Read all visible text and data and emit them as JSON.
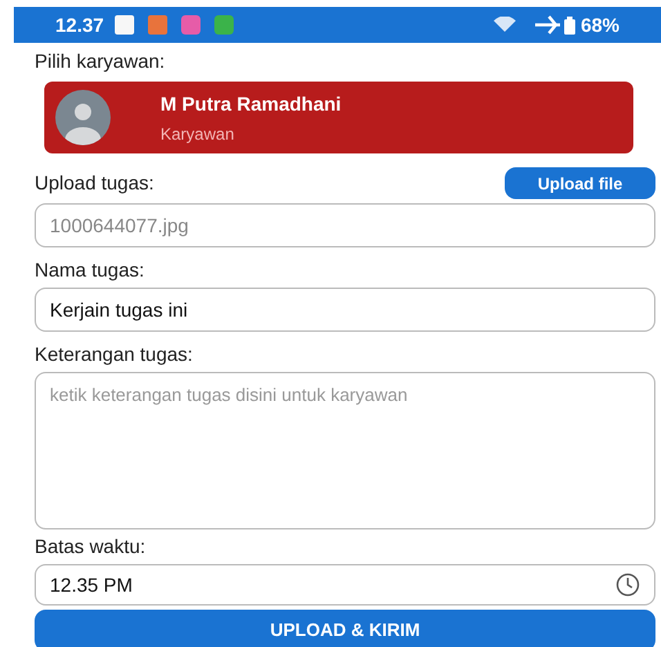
{
  "status_bar": {
    "time": "12.37",
    "battery": "68%"
  },
  "employee_section": {
    "label": "Pilih karyawan:",
    "employee": {
      "name": "M Putra Ramadhani",
      "role": "Karyawan"
    }
  },
  "upload": {
    "label": "Upload tugas:",
    "button": "Upload file",
    "value": "1000644077.jpg"
  },
  "task_name": {
    "label": "Nama tugas:",
    "value": "Kerjain tugas ini"
  },
  "description": {
    "label": "Keterangan tugas:",
    "placeholder": "ketik keterangan tugas disini untuk karyawan"
  },
  "deadline": {
    "label": "Batas waktu:",
    "value": "12.35 PM"
  },
  "submit_button": "UPLOAD & KIRIM"
}
